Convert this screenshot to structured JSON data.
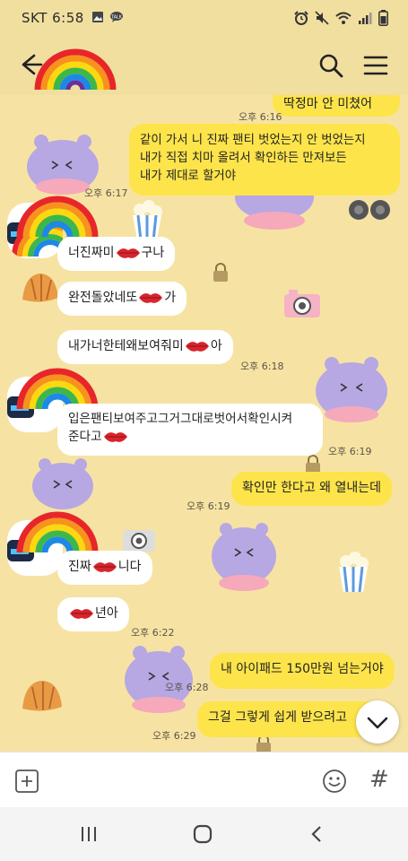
{
  "status_bar": {
    "carrier": "SKT 6:58"
  },
  "header": {
    "back_icon": "arrow-left-icon",
    "avatar": "rainbow-sticker",
    "search_icon": "search-icon",
    "menu_icon": "hamburger-menu-icon"
  },
  "colors": {
    "background": "#f6e3a3",
    "my_bubble": "#fde44b",
    "their_bubble": "#ffffff"
  },
  "messages": [
    {
      "sender": "me",
      "text": "딱정마 안 미쳤어",
      "time": "오후 6:16"
    },
    {
      "sender": "me",
      "line1": "같이 가서 니 진짜 팬티 벗었는지 안 벗었는지",
      "line2": "내가 직접 치마 올려서 확인하든 만져보든",
      "line3": "내가 제대로 할거야",
      "time": "오후 6:17"
    },
    {
      "sender": "them",
      "text": "너진짜미",
      "text_after": "구나"
    },
    {
      "sender": "them",
      "text": "완전돌았네또",
      "text_after": "가"
    },
    {
      "sender": "them",
      "text": "내가너한테왜보여줘미",
      "text_after": "아",
      "time": "오후 6:18"
    },
    {
      "sender": "them",
      "line1": "입은팬티보여주고그거그대로벗어서확인시켜",
      "line2": "준다고",
      "time": "오후 6:19"
    },
    {
      "sender": "me",
      "text": "확인만 한다고 왜 열내는데",
      "time": "오후 6:19"
    },
    {
      "sender": "them",
      "text": "진짜",
      "text_after": "니다"
    },
    {
      "sender": "them",
      "text_after": "년아",
      "time": "오후 6:22"
    },
    {
      "sender": "me",
      "text": "내 아이패드 150만원 넘는거야",
      "time": "오후 6:28"
    },
    {
      "sender": "me",
      "text": "그걸 그렇게 쉽게 받으려고",
      "time": "오후 6:29"
    }
  ],
  "input_bar": {
    "plus_icon": "plus-icon",
    "emoji_icon": "emoji-icon",
    "hash_label": "#"
  },
  "nav_bar": {
    "recents_icon": "recents-icon",
    "home_icon": "home-icon",
    "back_icon": "back-chevron-icon"
  }
}
